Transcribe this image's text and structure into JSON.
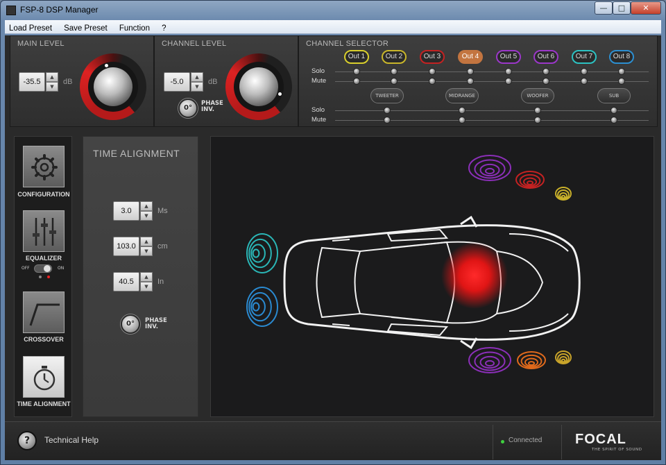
{
  "window": {
    "title": "FSP-8 DSP Manager",
    "minimize": "—",
    "maximize": "□",
    "close": "✕"
  },
  "menu": {
    "items": [
      "Load Preset",
      "Save Preset",
      "Function",
      "?"
    ]
  },
  "main_level": {
    "title": "MAIN LEVEL",
    "value": "-35.5",
    "unit": "dB"
  },
  "channel_level": {
    "title": "CHANNEL LEVEL",
    "value": "-5.0",
    "unit": "dB",
    "phase_button": "0°",
    "phase_label_1": "PHASE",
    "phase_label_2": "INV."
  },
  "channel_selector": {
    "title": "CHANNEL SELECTOR",
    "outputs": [
      {
        "label": "Out 1",
        "color": "#d9cf2c"
      },
      {
        "label": "Out 2",
        "color": "#c9b62a"
      },
      {
        "label": "Out 3",
        "color": "#c42222"
      },
      {
        "label": "Out 4",
        "color": "#c37540",
        "active": true
      },
      {
        "label": "Out 5",
        "color": "#9b37c9"
      },
      {
        "label": "Out 6",
        "color": "#9b37c9"
      },
      {
        "label": "Out 7",
        "color": "#2cc2c2"
      },
      {
        "label": "Out 8",
        "color": "#2c8fd1"
      }
    ],
    "solo_label": "Solo",
    "mute_label": "Mute",
    "groups": [
      "TWEETER",
      "MIDRANGE",
      "WOOFER",
      "SUB"
    ]
  },
  "nav": {
    "configuration": "CONFIGURATION",
    "equalizer": "EQUALIZER",
    "eq_off": "OFF",
    "eq_on": "ON",
    "crossover": "CROSSOVER",
    "time_alignment": "TIME ALIGNMENT"
  },
  "time_alignment": {
    "title": "TIME ALIGNMENT",
    "ms_value": "3.0",
    "ms_unit": "Ms",
    "cm_value": "103.0",
    "cm_unit": "cm",
    "in_value": "40.5",
    "in_unit": "In",
    "phase_button": "0°",
    "phase_label_1": "PHASE",
    "phase_label_2": "INV."
  },
  "stage": {
    "speaker_colors": {
      "front_left": "#2ab6b6",
      "rear_left": "#2a8ad1",
      "rear_top_woofer": "#8b2fb8",
      "rear_top_mid": "#c42222",
      "rear_top_tweeter": "#c9b02a",
      "rear_bottom_woofer": "#8b2fb8",
      "rear_bottom_mid": "#e06a1c",
      "rear_bottom_tweeter": "#c9a42a",
      "listener_glow": "#ff1a1a"
    }
  },
  "footer": {
    "help_icon": "?",
    "help_label": "Technical Help",
    "status": "Connected",
    "brand": "FOCAL",
    "tagline": "THE SPIRIT OF SOUND"
  }
}
